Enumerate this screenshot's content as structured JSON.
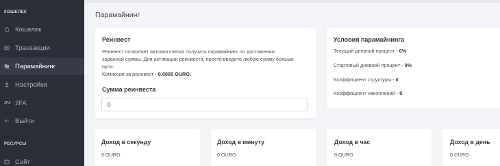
{
  "sidebar": {
    "section_wallet": "КОШЕЛЕК",
    "items": [
      {
        "label": "Кошелек",
        "icon": "home-icon"
      },
      {
        "label": "Транзакции",
        "icon": "list-icon"
      },
      {
        "label": "Парамайнинг",
        "icon": "stack-icon"
      },
      {
        "label": "Настройки",
        "icon": "user-icon"
      },
      {
        "label": "2FA",
        "icon_text": "2FA"
      },
      {
        "label": "Выйти",
        "icon": "arrow-left-icon"
      }
    ],
    "section_resources": "РЕСУРСЫ",
    "resource_items": [
      {
        "label": "Сайт",
        "icon": "browser-icon"
      }
    ]
  },
  "header": {
    "title": "Парамайнинг"
  },
  "reinvest": {
    "title": "Реинвест",
    "desc_line1": "Реинвест позволяет автоматически получать парамайнинг по достижению",
    "desc_line2": "заданной суммы. Для активации реинвеста, просто введите любую сумму больше",
    "desc_line3": "нуля.",
    "commission_label": "Комиссия за реинвест - ",
    "commission_value": "0.0005 OURO.",
    "amount_label": "Сумма реинвеста",
    "amount_value": "0"
  },
  "conditions": {
    "title": "Условия парамайнинга",
    "rows": [
      {
        "label": "Текущий дневной процент - ",
        "value": "0%"
      },
      {
        "label": "Стартовый дневной процент - ",
        "value": "0%"
      },
      {
        "label": "Коэффициент структуры - ",
        "value": "0"
      },
      {
        "label": "Коэффициент накоплений - ",
        "value": "0"
      }
    ]
  },
  "income": [
    {
      "title": "Доход в секунду",
      "value": "0 OURO"
    },
    {
      "title": "Доход в минуту",
      "value": "0 OURO"
    },
    {
      "title": "Доход в час",
      "value": "0 OURO"
    },
    {
      "title": "Доход в день",
      "value": "0 OURO"
    }
  ],
  "colors": {
    "sidebar_bg": "#2a2f3a",
    "active_bg": "#363c49",
    "page_bg": "#f3f4f7"
  }
}
